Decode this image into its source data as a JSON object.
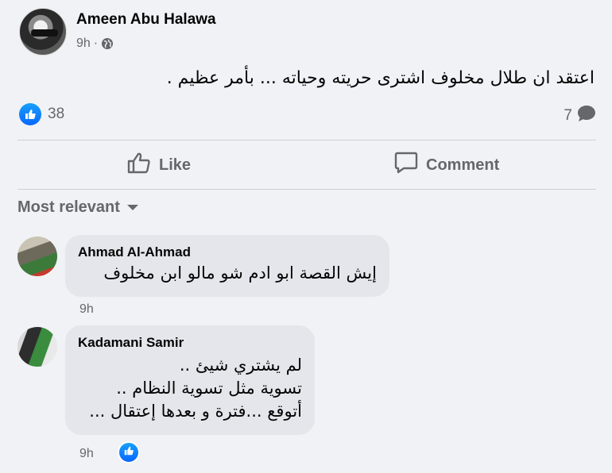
{
  "post": {
    "author": "Ameen Abu Halawa",
    "time": "9h",
    "separator": "·",
    "text": "اعتقد ان طلال مخلوف اشترى حريته وحياته ... بأمر عظيم .",
    "reaction_count": "38",
    "comment_count": "7"
  },
  "actions": {
    "like_label": "Like",
    "comment_label": "Comment"
  },
  "comments_section": {
    "sort_label": "Most relevant"
  },
  "comments": [
    {
      "author": "Ahmad Al-Ahmad",
      "lines": [
        "إيش القصة ابو ادم شو مالو ابن مخلوف"
      ],
      "time": "9h"
    },
    {
      "author": "Kadamani Samir",
      "lines": [
        "لم يشتري شيئ ..",
        "تسوية مثل تسوية النظام ..",
        "أتوقع ...فترة و بعدها إعتقال ..."
      ],
      "time": "9h"
    }
  ],
  "colors": {
    "background": "#f0f2f5",
    "secondary_text": "#65676b",
    "bubble": "#e4e6eb",
    "like_blue": "#0866ff"
  }
}
